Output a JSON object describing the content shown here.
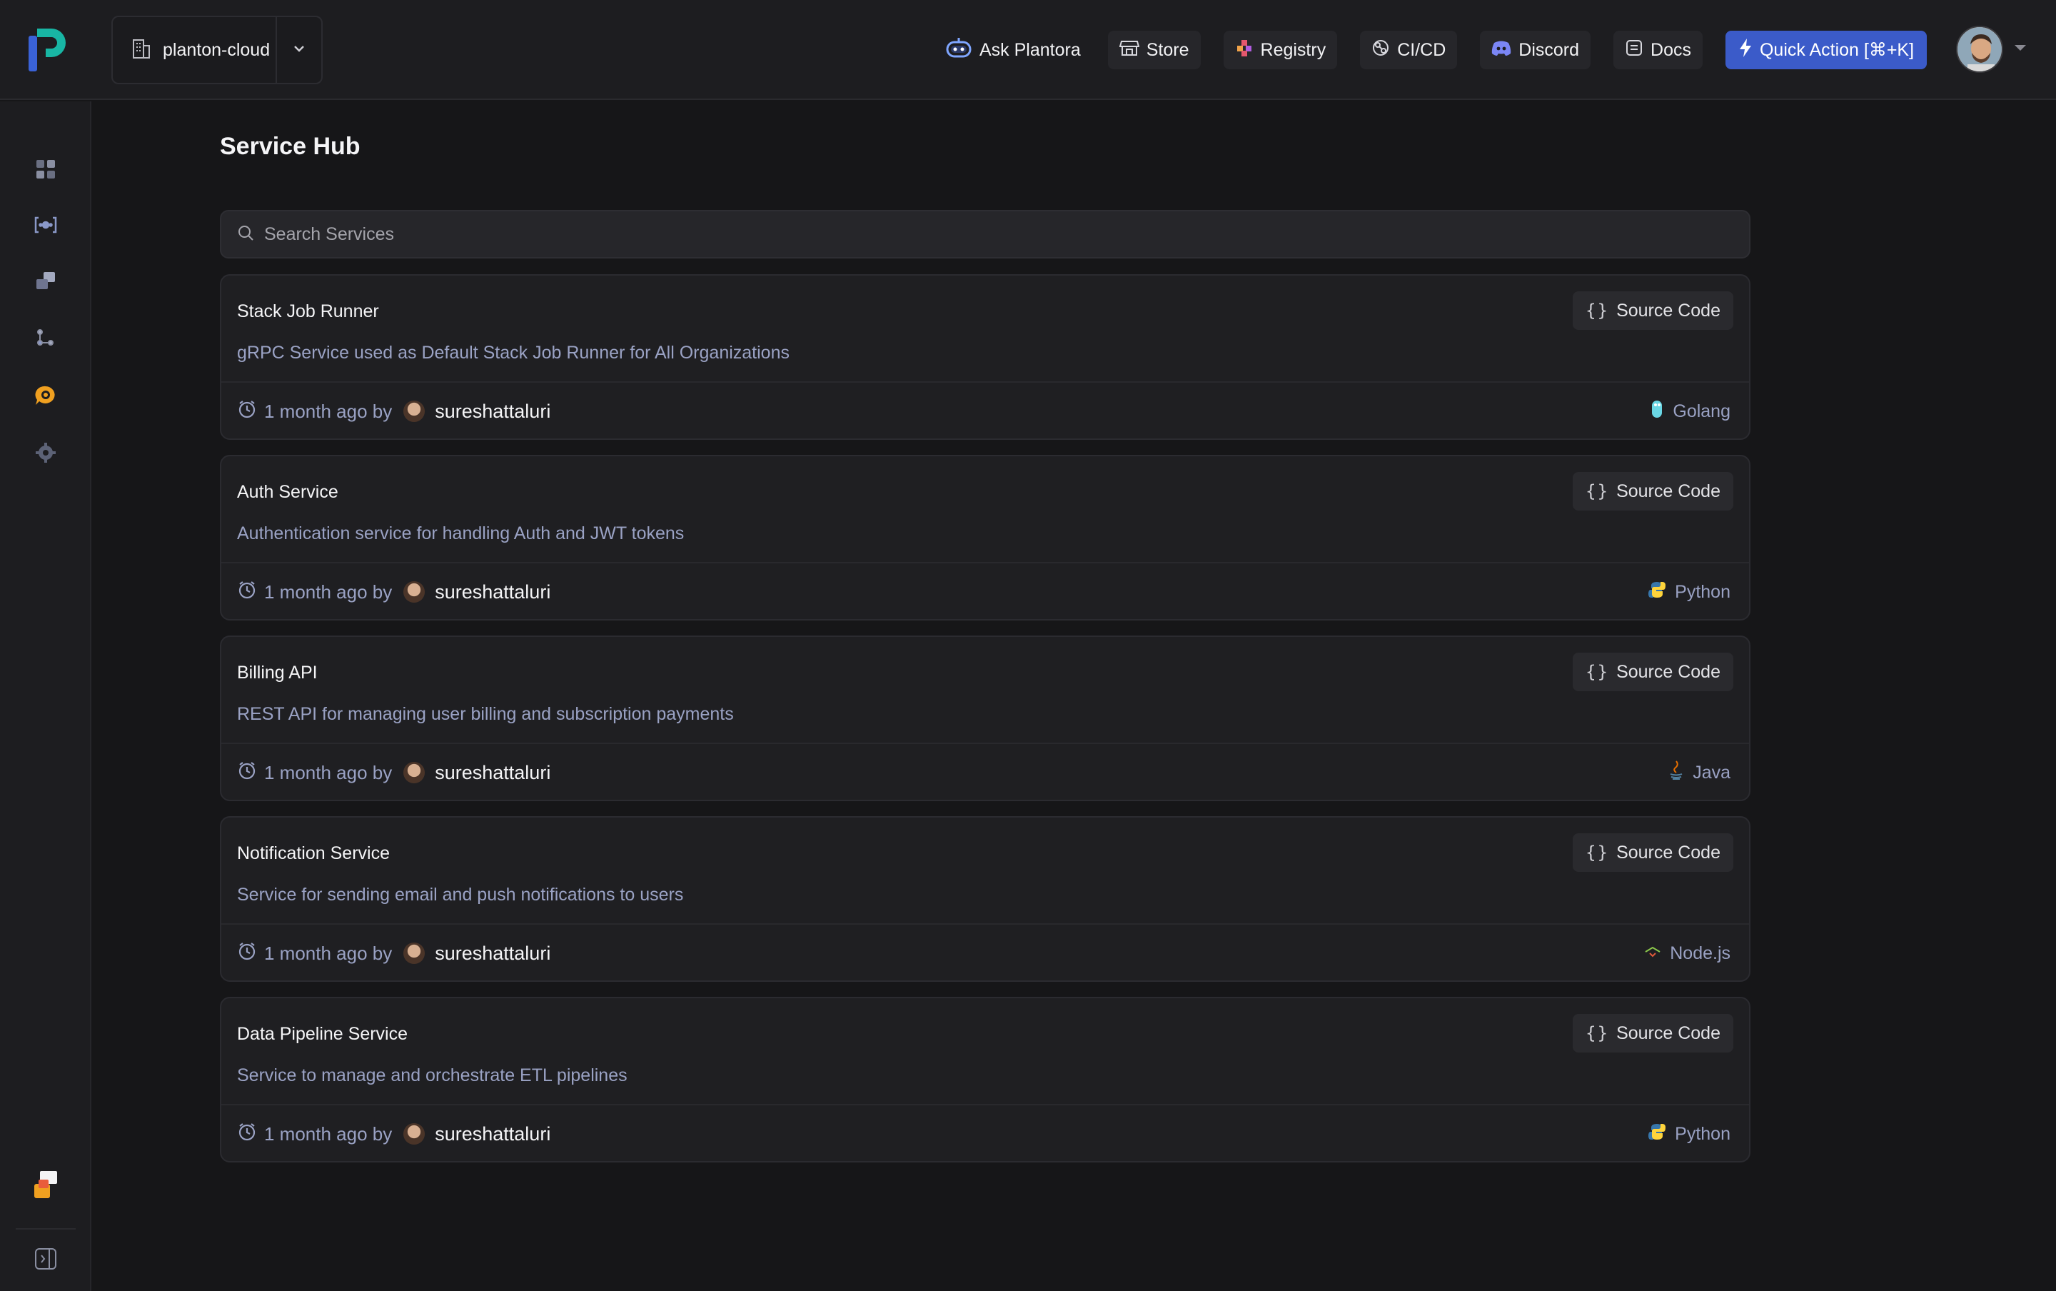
{
  "org_switcher": {
    "name": "planton-cloud"
  },
  "nav": {
    "ask": "Ask Plantora",
    "store": "Store",
    "registry": "Registry",
    "cicd": "CI/CD",
    "discord": "Discord",
    "docs": "Docs",
    "quick_action": "Quick Action [⌘+K]"
  },
  "sidebar": {
    "items": [
      "dashboard-icon",
      "connections-icon",
      "resources-icon",
      "graph-icon",
      "plantora-icon",
      "settings-icon"
    ],
    "bottom": [
      "feedback-icon",
      "collapse-sidebar-icon"
    ]
  },
  "page": {
    "title": "Service Hub"
  },
  "search": {
    "placeholder": "Search Services"
  },
  "services": [
    {
      "name": "Stack Job Runner",
      "description": "gRPC Service used as Default Stack Job Runner for All Organizations",
      "updated": "1 month ago by",
      "author": "sureshattaluri",
      "language": "Golang",
      "source_label": "Source Code"
    },
    {
      "name": "Auth Service",
      "description": "Authentication service for handling Auth and JWT tokens",
      "updated": "1 month ago by",
      "author": "sureshattaluri",
      "language": "Python",
      "source_label": "Source Code"
    },
    {
      "name": "Billing API",
      "description": "REST API for managing user billing and subscription payments",
      "updated": "1 month ago by",
      "author": "sureshattaluri",
      "language": "Java",
      "source_label": "Source Code"
    },
    {
      "name": "Notification Service",
      "description": "Service for sending email and push notifications to users",
      "updated": "1 month ago by",
      "author": "sureshattaluri",
      "language": "Node.js",
      "source_label": "Source Code"
    },
    {
      "name": "Data Pipeline Service",
      "description": "Service to manage and orchestrate ETL pipelines",
      "updated": "1 month ago by",
      "author": "sureshattaluri",
      "language": "Python",
      "source_label": "Source Code"
    }
  ],
  "colors": {
    "background": "#161618",
    "surface": "#1f1f22",
    "accent": "#3b5bc9",
    "brand_teal": "#18b6a4",
    "brand_blue": "#3a62d7",
    "muted_text": "#9aa2c4"
  }
}
